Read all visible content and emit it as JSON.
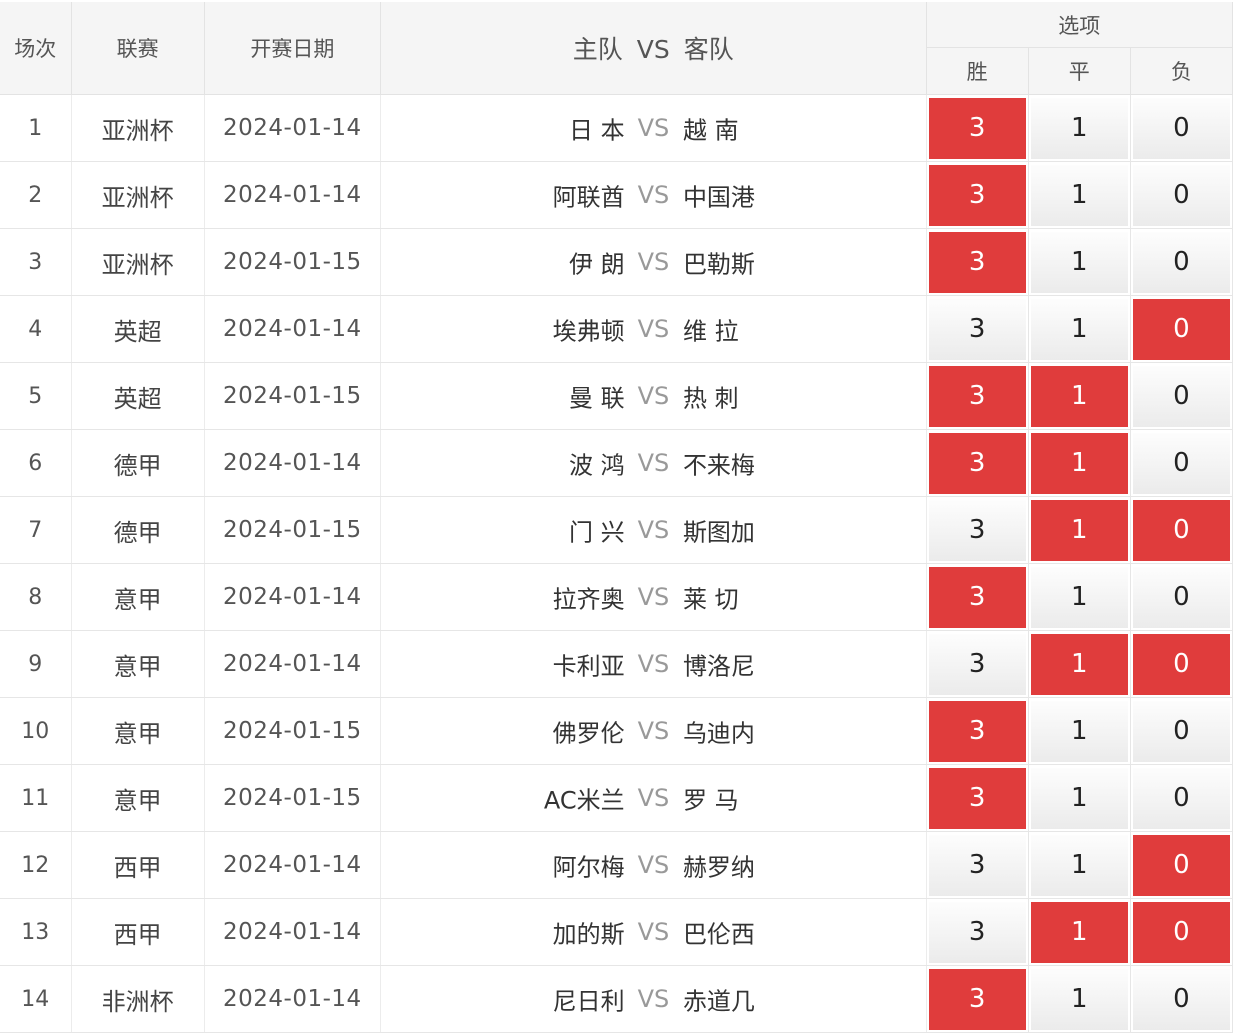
{
  "header": {
    "idx": "场次",
    "league": "联赛",
    "date": "开赛日期",
    "home": "主队",
    "vs": "VS",
    "away": "客队",
    "options": "选项",
    "win": "胜",
    "draw": "平",
    "loss": "负"
  },
  "colors": {
    "selected": "#e03c3c",
    "header_bg": "#f5f5f5"
  },
  "rows": [
    {
      "idx": "1",
      "league": "亚洲杯",
      "date": "2024-01-14",
      "home": "日 本",
      "vs": "VS",
      "away": "越 南",
      "win": "3",
      "draw": "1",
      "loss": "0",
      "sel": [
        true,
        false,
        false
      ]
    },
    {
      "idx": "2",
      "league": "亚洲杯",
      "date": "2024-01-14",
      "home": "阿联酋",
      "vs": "VS",
      "away": "中国港",
      "win": "3",
      "draw": "1",
      "loss": "0",
      "sel": [
        true,
        false,
        false
      ]
    },
    {
      "idx": "3",
      "league": "亚洲杯",
      "date": "2024-01-15",
      "home": "伊 朗",
      "vs": "VS",
      "away": "巴勒斯",
      "win": "3",
      "draw": "1",
      "loss": "0",
      "sel": [
        true,
        false,
        false
      ]
    },
    {
      "idx": "4",
      "league": "英超",
      "date": "2024-01-14",
      "home": "埃弗顿",
      "vs": "VS",
      "away": "维 拉",
      "win": "3",
      "draw": "1",
      "loss": "0",
      "sel": [
        false,
        false,
        true
      ]
    },
    {
      "idx": "5",
      "league": "英超",
      "date": "2024-01-15",
      "home": "曼 联",
      "vs": "VS",
      "away": "热 刺",
      "win": "3",
      "draw": "1",
      "loss": "0",
      "sel": [
        true,
        true,
        false
      ]
    },
    {
      "idx": "6",
      "league": "德甲",
      "date": "2024-01-14",
      "home": "波 鸿",
      "vs": "VS",
      "away": "不来梅",
      "win": "3",
      "draw": "1",
      "loss": "0",
      "sel": [
        true,
        true,
        false
      ]
    },
    {
      "idx": "7",
      "league": "德甲",
      "date": "2024-01-15",
      "home": "门 兴",
      "vs": "VS",
      "away": "斯图加",
      "win": "3",
      "draw": "1",
      "loss": "0",
      "sel": [
        false,
        true,
        true
      ]
    },
    {
      "idx": "8",
      "league": "意甲",
      "date": "2024-01-14",
      "home": "拉齐奥",
      "vs": "VS",
      "away": "莱 切",
      "win": "3",
      "draw": "1",
      "loss": "0",
      "sel": [
        true,
        false,
        false
      ]
    },
    {
      "idx": "9",
      "league": "意甲",
      "date": "2024-01-14",
      "home": "卡利亚",
      "vs": "VS",
      "away": "博洛尼",
      "win": "3",
      "draw": "1",
      "loss": "0",
      "sel": [
        false,
        true,
        true
      ]
    },
    {
      "idx": "10",
      "league": "意甲",
      "date": "2024-01-15",
      "home": "佛罗伦",
      "vs": "VS",
      "away": "乌迪内",
      "win": "3",
      "draw": "1",
      "loss": "0",
      "sel": [
        true,
        false,
        false
      ]
    },
    {
      "idx": "11",
      "league": "意甲",
      "date": "2024-01-15",
      "home": "AC米兰",
      "vs": "VS",
      "away": "罗 马",
      "win": "3",
      "draw": "1",
      "loss": "0",
      "sel": [
        true,
        false,
        false
      ]
    },
    {
      "idx": "12",
      "league": "西甲",
      "date": "2024-01-14",
      "home": "阿尔梅",
      "vs": "VS",
      "away": "赫罗纳",
      "win": "3",
      "draw": "1",
      "loss": "0",
      "sel": [
        false,
        false,
        true
      ]
    },
    {
      "idx": "13",
      "league": "西甲",
      "date": "2024-01-14",
      "home": "加的斯",
      "vs": "VS",
      "away": "巴伦西",
      "win": "3",
      "draw": "1",
      "loss": "0",
      "sel": [
        false,
        true,
        true
      ]
    },
    {
      "idx": "14",
      "league": "非洲杯",
      "date": "2024-01-14",
      "home": "尼日利",
      "vs": "VS",
      "away": "赤道几",
      "win": "3",
      "draw": "1",
      "loss": "0",
      "sel": [
        true,
        false,
        false
      ]
    }
  ]
}
